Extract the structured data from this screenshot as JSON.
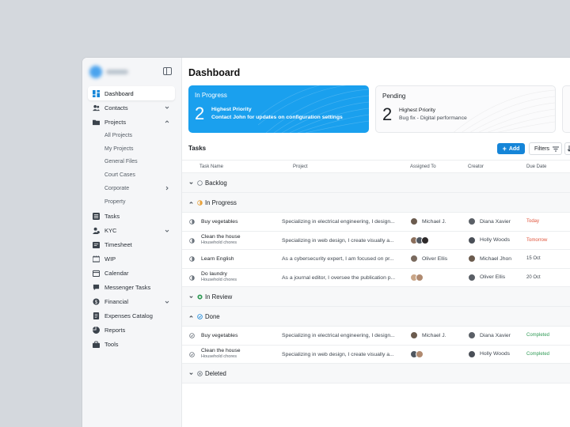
{
  "sidebar": {
    "nav": [
      {
        "label": "Dashboard",
        "icon": "dashboard-icon"
      },
      {
        "label": "Contacts",
        "icon": "contacts-icon"
      },
      {
        "label": "Projects",
        "icon": "folder-icon"
      },
      {
        "label": "All Projects"
      },
      {
        "label": "My Projects"
      },
      {
        "label": "General Files"
      },
      {
        "label": "Court Cases"
      },
      {
        "label": "Corporate"
      },
      {
        "label": "Property"
      },
      {
        "label": "Tasks",
        "icon": "tasks-icon"
      },
      {
        "label": "KYC",
        "icon": "kyc-icon"
      },
      {
        "label": "Timesheet",
        "icon": "timesheet-icon"
      },
      {
        "label": "WIP",
        "icon": "wip-icon"
      },
      {
        "label": "Calendar",
        "icon": "calendar-icon"
      },
      {
        "label": "Messenger Tasks",
        "icon": "messenger-icon"
      },
      {
        "label": "Financial",
        "icon": "financial-icon"
      },
      {
        "label": "Expenses Catalog",
        "icon": "catalog-icon"
      },
      {
        "label": "Reports",
        "icon": "reports-icon"
      },
      {
        "label": "Tools",
        "icon": "tools-icon"
      }
    ]
  },
  "main": {
    "title": "Dashboard",
    "cards": [
      {
        "title": "In Progress",
        "count": "2",
        "line1": "Highest Priority",
        "line2": "Contact John for updates on configuration settings"
      },
      {
        "title": "Pending",
        "count": "2",
        "line1": "Highest Priority",
        "line2": "Bug fix - Digital performance"
      }
    ],
    "tasks_title": "Tasks",
    "add_label": "Add",
    "filters_label": "Filters",
    "columns": [
      "Task Name",
      "Project",
      "Assigned To",
      "Creator",
      "Due Date"
    ],
    "groups": {
      "backlog": "Backlog",
      "in_progress": "In Progress",
      "in_review": "In Review",
      "done": "Done",
      "deleted": "Deleted"
    },
    "in_progress_rows": [
      {
        "name": "Buy vegetables",
        "sub": "",
        "project": "Specializing in electrical engineering, I design...",
        "assigned": "Michael J.",
        "creator": "Diana Xavier",
        "due": "Today"
      },
      {
        "name": "Clean the house",
        "sub": "Household chores",
        "project": "Specializing in web design, I create visually a...",
        "assigned": "",
        "creator": "Holly Woods",
        "due": "Tomorrow"
      },
      {
        "name": "Learn English",
        "sub": "",
        "project": "As a cybersecurity expert, I am focused on pr...",
        "assigned": "Oliver Ellis",
        "creator": "Michael Jhon",
        "due": "15 Oct"
      },
      {
        "name": "Do laundry",
        "sub": "Household chores",
        "project": "As a journal editor, I oversee the publication p...",
        "assigned": "",
        "creator": "Oliver Ellis",
        "due": "20 Oct"
      }
    ],
    "done_rows": [
      {
        "name": "Buy vegetables",
        "sub": "",
        "project": "Specializing in electrical engineering, I design...",
        "assigned": "Michael J.",
        "creator": "Diana Xavier",
        "due": "Completed"
      },
      {
        "name": "Clean the house",
        "sub": "Household chores",
        "project": "Specializing in web design, I create visually a...",
        "assigned": "",
        "creator": "Holly Woods",
        "due": "Completed"
      }
    ]
  },
  "colors": {
    "accent": "#1aa0ee",
    "today": "#e0533a",
    "completed": "#2f9a55",
    "date": "#3e464f"
  }
}
